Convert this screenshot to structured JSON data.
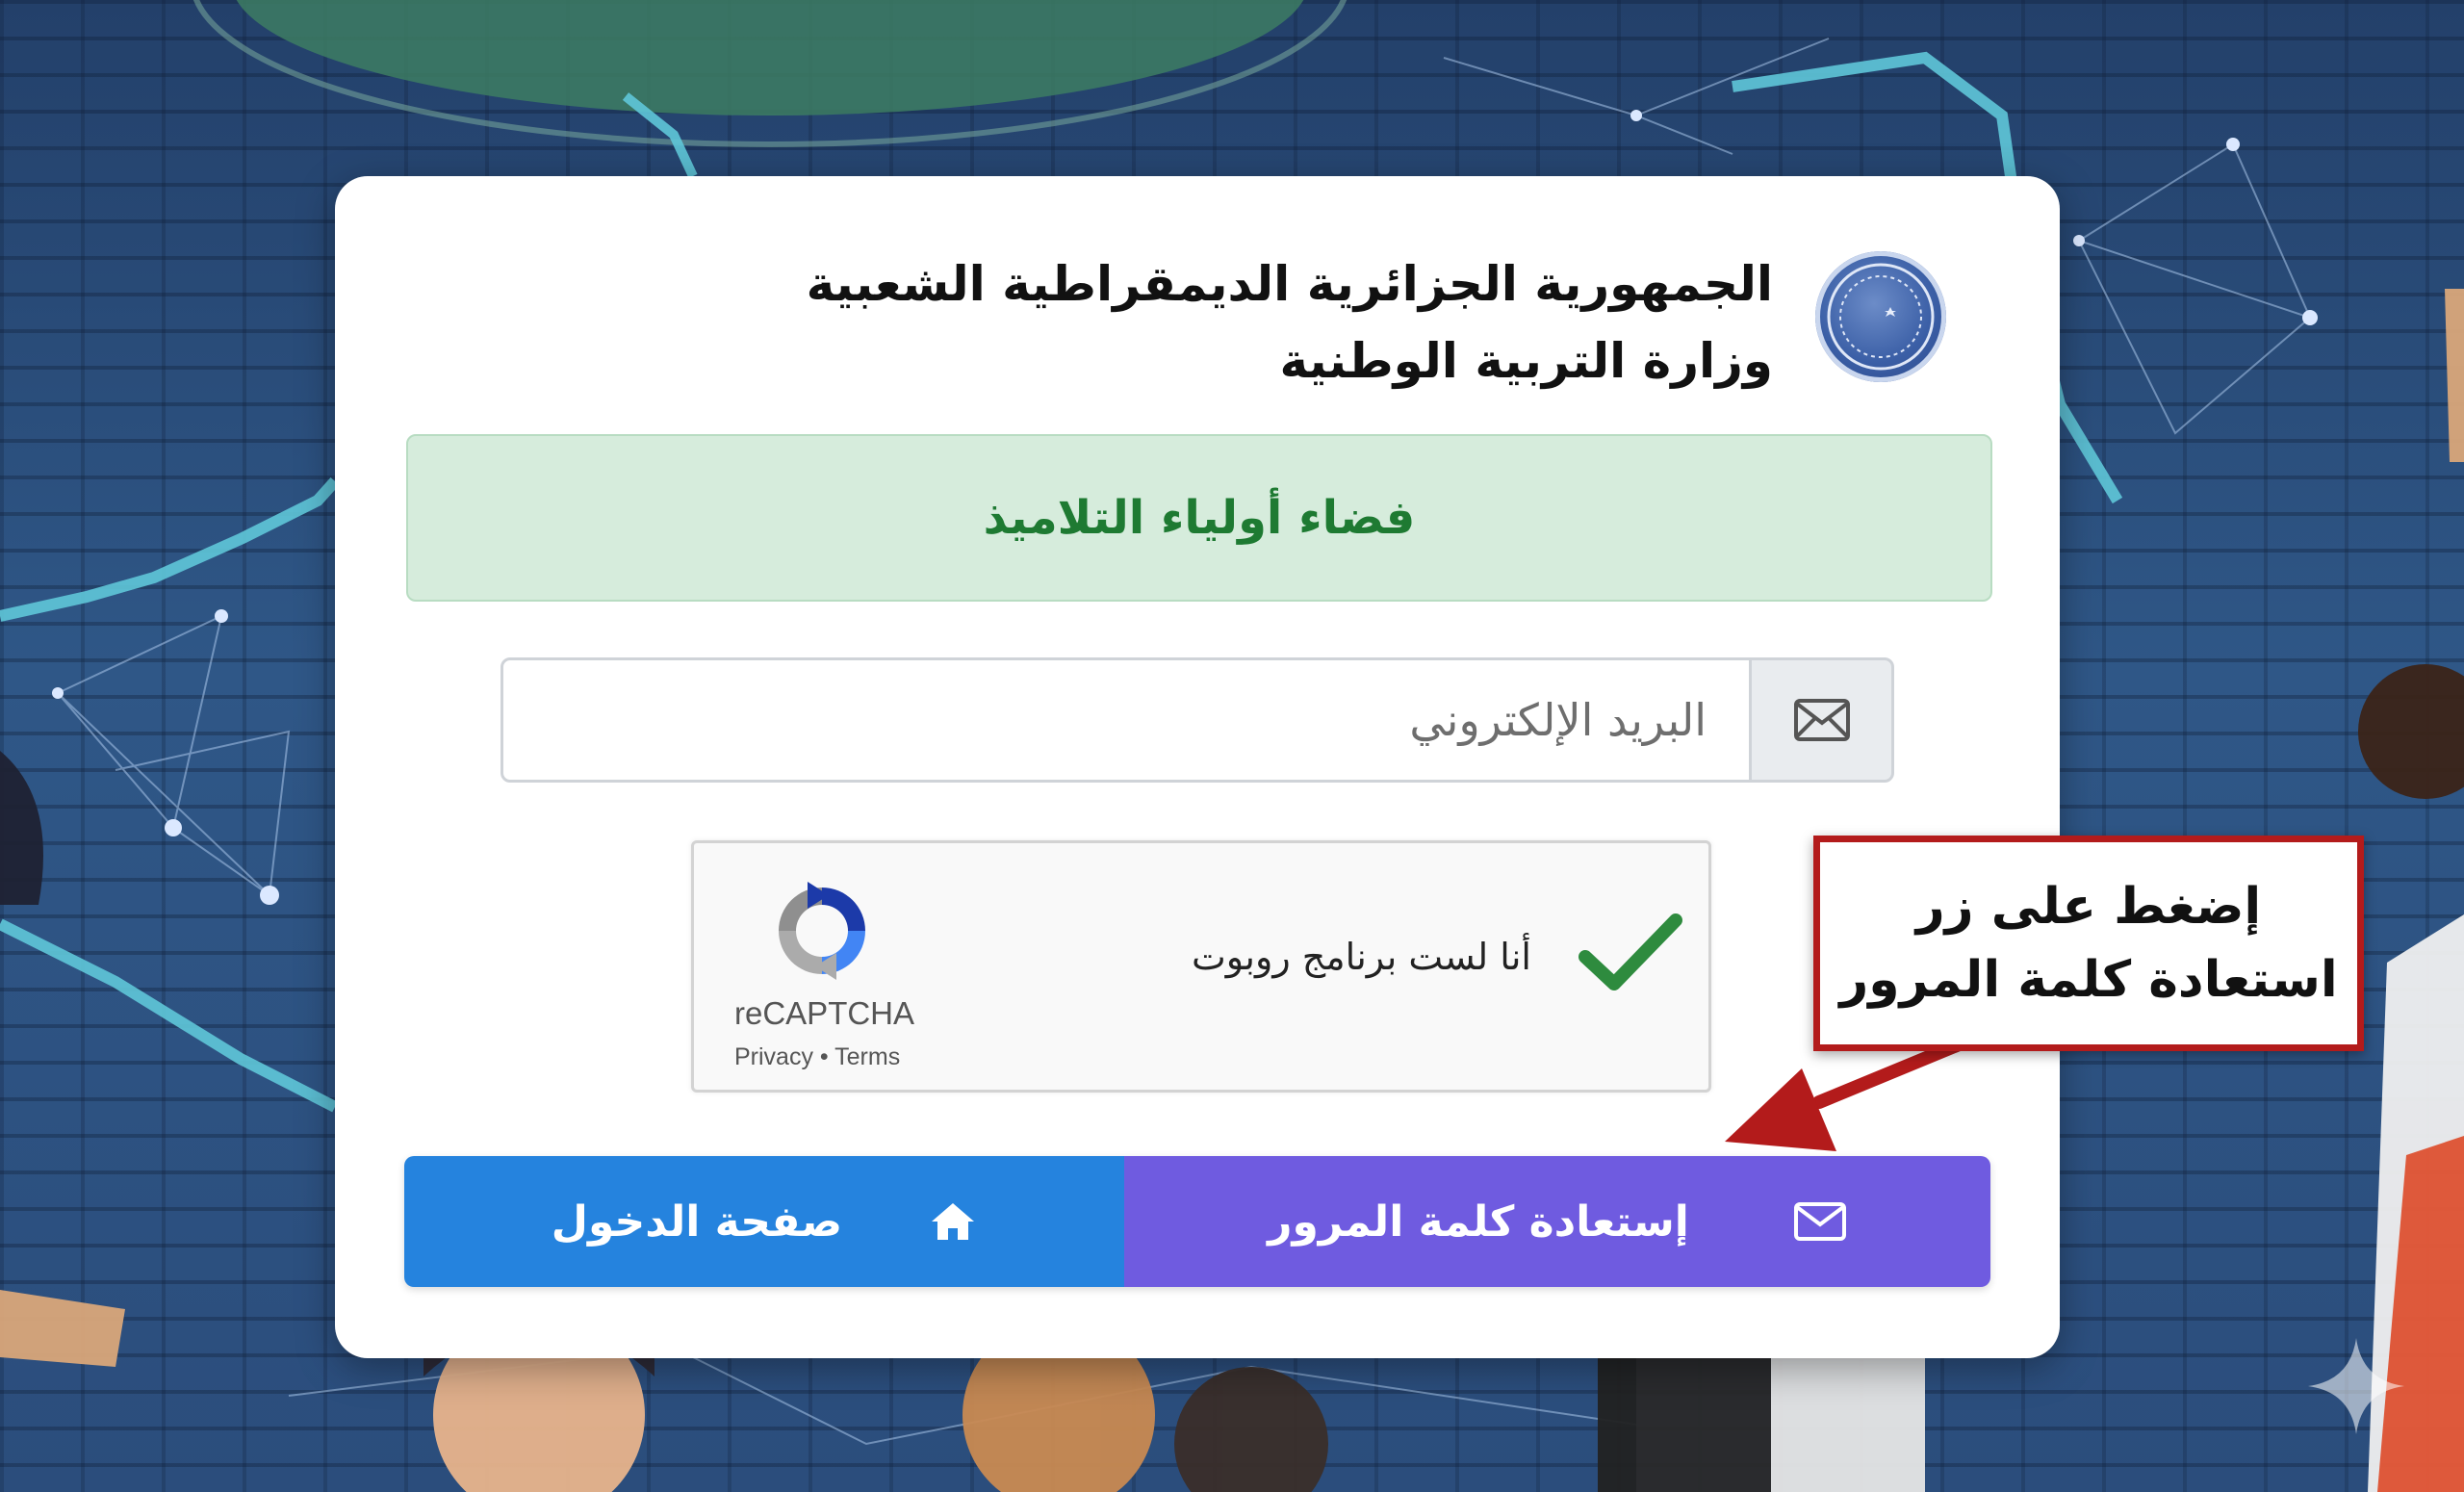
{
  "header": {
    "line1": "الجمهورية الجزائرية الديمقراطية الشعبية",
    "line2": "وزارة التربية الوطنية",
    "emblem": "algeria-seal-icon"
  },
  "banner": {
    "title": "فضاء أولياء التلاميذ"
  },
  "email": {
    "placeholder": "البريد الإلكتروني",
    "value": "",
    "icon": "envelope-icon"
  },
  "recaptcha": {
    "label": "أنا لست برنامج روبوت",
    "brand": "reCAPTCHA",
    "links": "Privacy • Terms",
    "checked": true
  },
  "buttons": {
    "recover_label": "إستعادة كلمة المرور",
    "recover_icon": "envelope-icon",
    "login_label": "صفحة الدخول",
    "login_icon": "home-icon"
  },
  "annotation": {
    "text": "إضغط على زر استعادة كلمة المرور"
  },
  "colors": {
    "banner_bg": "#d6ecdc",
    "banner_text": "#1e7a32",
    "login_button": "#2583de",
    "recover_button": "#6f5be0",
    "callout_border": "#b31b1b",
    "check": "#2e8b3e"
  }
}
